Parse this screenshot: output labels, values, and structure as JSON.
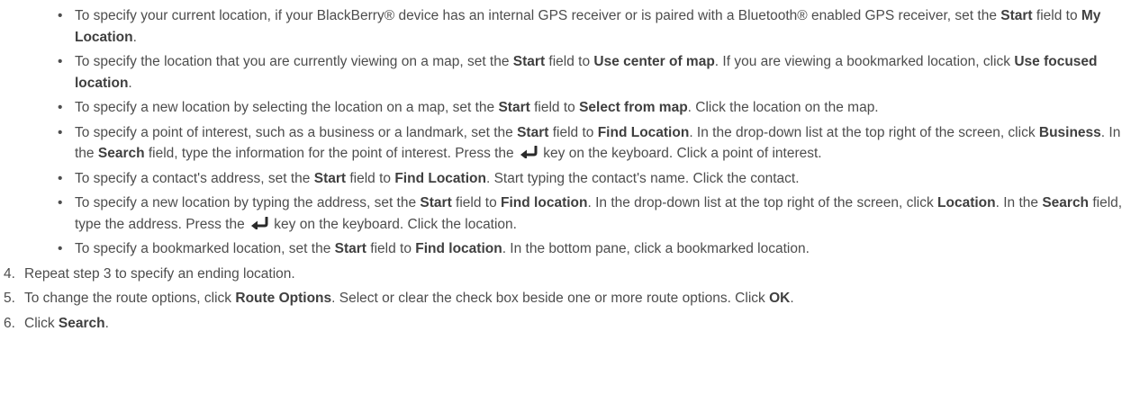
{
  "bullets": [
    {
      "parts": [
        {
          "t": "To specify your current location, if your BlackBerry® device has an internal GPS receiver or is paired with a Bluetooth® enabled GPS receiver, set the "
        },
        {
          "t": "Start",
          "b": true
        },
        {
          "t": " field to "
        },
        {
          "t": "My Location",
          "b": true
        },
        {
          "t": "."
        }
      ]
    },
    {
      "parts": [
        {
          "t": "To specify the location that you are currently viewing on a map, set the "
        },
        {
          "t": "Start",
          "b": true
        },
        {
          "t": " field to "
        },
        {
          "t": "Use center of map",
          "b": true
        },
        {
          "t": ". If you are viewing a bookmarked location, click "
        },
        {
          "t": "Use focused location",
          "b": true
        },
        {
          "t": "."
        }
      ]
    },
    {
      "parts": [
        {
          "t": "To specify a new location by selecting the location on a map, set the "
        },
        {
          "t": "Start",
          "b": true
        },
        {
          "t": " field to "
        },
        {
          "t": "Select from map",
          "b": true
        },
        {
          "t": ". Click the location on the map."
        }
      ]
    },
    {
      "parts": [
        {
          "t": "To specify a point of interest, such as a business or a landmark, set the "
        },
        {
          "t": "Start",
          "b": true
        },
        {
          "t": " field to "
        },
        {
          "t": "Find Location",
          "b": true
        },
        {
          "t": ". In the drop-down list at the top right of the screen, click "
        },
        {
          "t": "Business",
          "b": true
        },
        {
          "t": ". In the "
        },
        {
          "t": "Search",
          "b": true
        },
        {
          "t": " field, type the information for the point of interest. Press the "
        },
        {
          "icon": "enter-key-icon"
        },
        {
          "t": " key on the keyboard. Click a point of interest."
        }
      ]
    },
    {
      "parts": [
        {
          "t": "To specify a contact's address, set the "
        },
        {
          "t": "Start",
          "b": true
        },
        {
          "t": " field to "
        },
        {
          "t": "Find Location",
          "b": true
        },
        {
          "t": ". Start typing the contact's name. Click the contact."
        }
      ]
    },
    {
      "parts": [
        {
          "t": "To specify a new location by typing the address, set the "
        },
        {
          "t": "Start",
          "b": true
        },
        {
          "t": " field to "
        },
        {
          "t": "Find location",
          "b": true
        },
        {
          "t": ". In the drop-down list at the top right of the screen, click "
        },
        {
          "t": "Location",
          "b": true
        },
        {
          "t": ". In the "
        },
        {
          "t": "Search",
          "b": true
        },
        {
          "t": " field, type the address. Press the "
        },
        {
          "icon": "enter-key-icon"
        },
        {
          "t": " key on the keyboard. Click the location."
        }
      ]
    },
    {
      "parts": [
        {
          "t": "To specify a bookmarked location, set the "
        },
        {
          "t": "Start",
          "b": true
        },
        {
          "t": " field to "
        },
        {
          "t": "Find location",
          "b": true
        },
        {
          "t": ". In the bottom pane, click a bookmarked location."
        }
      ]
    }
  ],
  "steps": [
    {
      "num": "4.",
      "parts": [
        {
          "t": "Repeat step 3 to specify an ending location."
        }
      ]
    },
    {
      "num": "5.",
      "parts": [
        {
          "t": "To change the route options, click "
        },
        {
          "t": "Route Options",
          "b": true
        },
        {
          "t": ". Select or clear the check box beside one or more route options. Click "
        },
        {
          "t": "OK",
          "b": true
        },
        {
          "t": "."
        }
      ]
    },
    {
      "num": "6.",
      "parts": [
        {
          "t": "Click "
        },
        {
          "t": "Search",
          "b": true
        },
        {
          "t": "."
        }
      ]
    }
  ],
  "colors": {
    "text": "#4d4d4d"
  }
}
